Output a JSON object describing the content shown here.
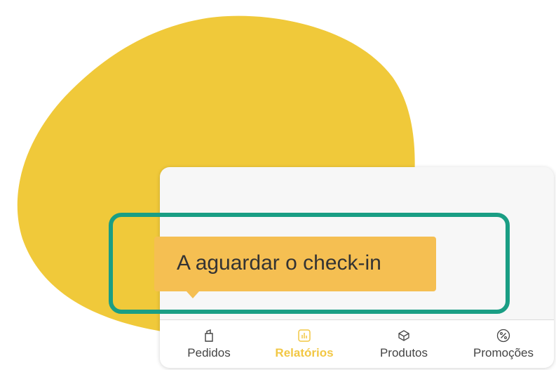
{
  "colors": {
    "blob": "#f0c93a",
    "highlight_border": "#1a9e84",
    "tooltip_bg": "#f5bf52",
    "active_tab": "#f2c744"
  },
  "tooltip": {
    "text": "A aguardar o check-in"
  },
  "tabs": [
    {
      "label": "Pedidos",
      "icon": "orders-icon",
      "active": false
    },
    {
      "label": "Relatórios",
      "icon": "reports-chart-icon",
      "active": true
    },
    {
      "label": "Produtos",
      "icon": "box-icon",
      "active": false
    },
    {
      "label": "Promoções",
      "icon": "percent-icon",
      "active": false
    }
  ]
}
